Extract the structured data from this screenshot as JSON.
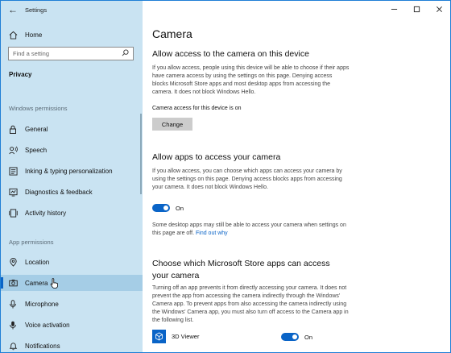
{
  "window": {
    "title": "Settings"
  },
  "sidebar": {
    "home_label": "Home",
    "search_placeholder": "Find a setting",
    "current_section": "Privacy",
    "groups": {
      "windows_permissions": "Windows permissions",
      "app_permissions": "App permissions"
    },
    "items": [
      {
        "label": "General",
        "icon": "lock-icon"
      },
      {
        "label": "Speech",
        "icon": "speech-icon"
      },
      {
        "label": "Inking & typing personalization",
        "icon": "inking-icon"
      },
      {
        "label": "Diagnostics & feedback",
        "icon": "diagnostics-icon"
      },
      {
        "label": "Activity history",
        "icon": "activity-icon"
      },
      {
        "label": "Location",
        "icon": "location-icon"
      },
      {
        "label": "Camera",
        "icon": "camera-icon",
        "active": true
      },
      {
        "label": "Microphone",
        "icon": "microphone-icon"
      },
      {
        "label": "Voice activation",
        "icon": "voice-icon"
      },
      {
        "label": "Notifications",
        "icon": "notifications-icon"
      }
    ]
  },
  "main": {
    "title": "Camera",
    "device_section": {
      "heading": "Allow access to the camera on this device",
      "description": "If you allow access, people using this device will be able to choose if their apps have camera access by using the settings on this page. Denying access blocks Microsoft Store apps and most desktop apps from accessing the camera. It does not block Windows Hello.",
      "status": "Camera access for this device is on",
      "button_label": "Change"
    },
    "apps_section": {
      "heading": "Allow apps to access your camera",
      "description": "If you allow access, you can choose which apps can access your camera by using the settings on this page. Denying access blocks apps from accessing your camera. It does not block Windows Hello.",
      "toggle_state": "On",
      "note": "Some desktop apps may still be able to access your camera when settings on this page are off.",
      "link": "Find out why"
    },
    "store_section": {
      "heading_line1": "Choose which Microsoft Store apps can access",
      "heading_line2": "your camera",
      "description": "Turning off an app prevents it from directly accessing your camera. It does not prevent the app from accessing the camera indirectly through the Windows' Camera app. To prevent apps from also accessing the camera indirectly using the Windows' Camera app, you must also turn off access to the Camera app in the following list.",
      "apps": [
        {
          "name": "3D Viewer",
          "toggle_state": "On"
        }
      ]
    }
  },
  "colors": {
    "accent": "#0a64c7",
    "sidebar_bg": "#c9e3f2",
    "active_bg": "#a5cde6"
  }
}
